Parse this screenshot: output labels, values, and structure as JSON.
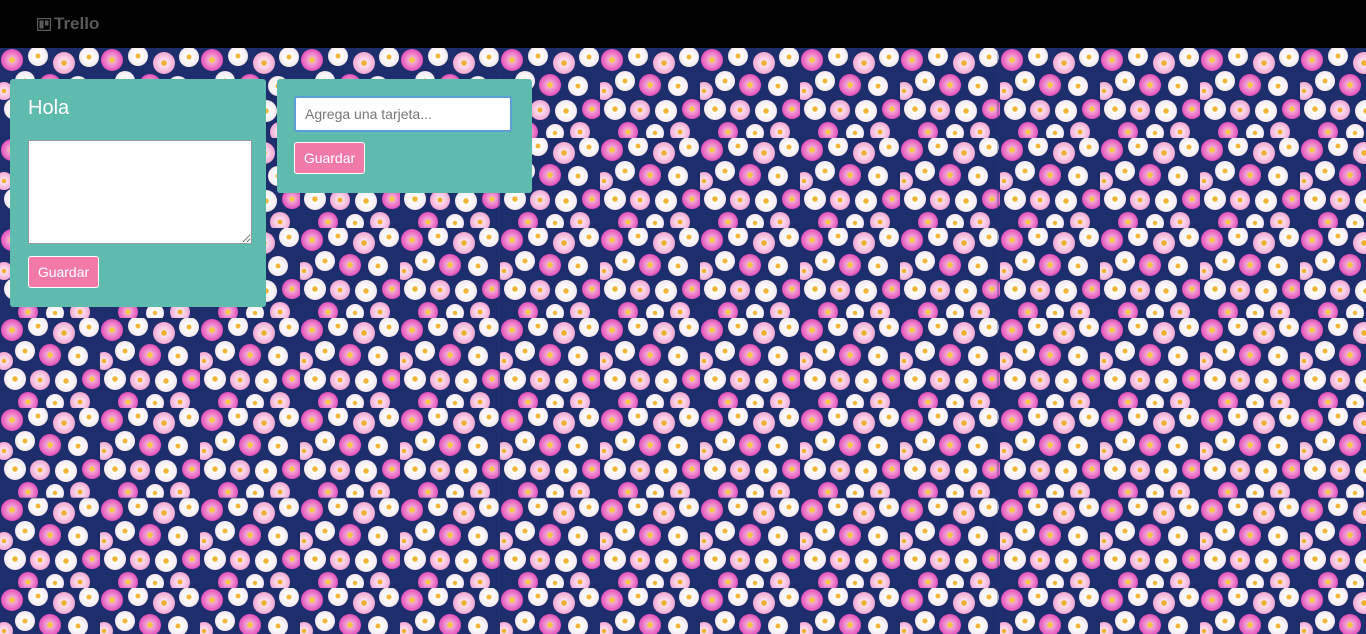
{
  "navbar": {
    "brand": "Trello"
  },
  "lists": [
    {
      "title": "Hola",
      "textarea_value": "",
      "save_label": "Guardar"
    }
  ],
  "add_card": {
    "placeholder": "Agrega una tarjeta...",
    "value": "",
    "save_label": "Guardar"
  },
  "colors": {
    "navbar": "#000000",
    "brand_text": "#5a5a5a",
    "card_bg": "#5fbbad",
    "button_bg": "#f27aaa",
    "input_focus_border": "#5d9ed6",
    "flower_pattern_base": "#1f2f6e"
  },
  "icons": {
    "brand": "trello-board-icon"
  },
  "background": {
    "description_name": "flower-pattern-background"
  }
}
